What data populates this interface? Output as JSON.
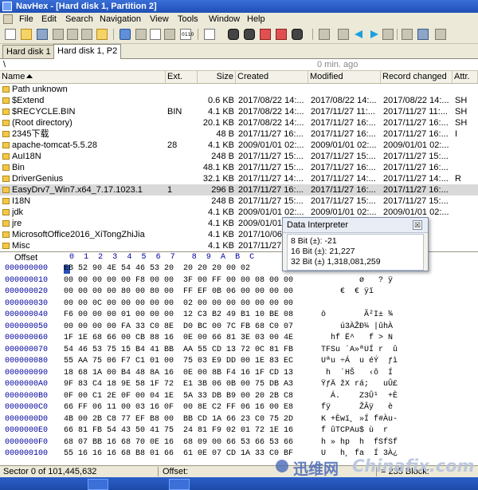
{
  "window": {
    "title": "NavHex - [Hard disk 1, Partition 2]"
  },
  "menu": [
    "File",
    "Edit",
    "Search",
    "Navigation",
    "View",
    "Tools",
    "Window",
    "Help"
  ],
  "toolbar_small_labels": {
    "hex1": "0110",
    "hex2": "HEX",
    "hex3": "HEX",
    "hex4": "HEX"
  },
  "tabs": [
    {
      "label": "Hard disk 1",
      "active": false
    },
    {
      "label": "Hard disk 1, P2",
      "active": true
    }
  ],
  "path": {
    "value": "\\",
    "ago": "0 min. ago"
  },
  "file_columns": [
    "Name",
    "Ext.",
    "Size",
    "Created",
    "Modified",
    "Record changed",
    "Attr."
  ],
  "files": [
    {
      "name": "Path unknown",
      "ext": "",
      "size": "",
      "created": "",
      "modified": "",
      "changed": "",
      "attr": ""
    },
    {
      "name": "$Extend",
      "ext": "",
      "size": "0.6 KB",
      "created": "2017/08/22  14:...",
      "modified": "2017/08/22  14:...",
      "changed": "2017/08/22  14:...",
      "attr": "SH"
    },
    {
      "name": "$RECYCLE.BIN",
      "ext": "BIN",
      "size": "4.1 KB",
      "created": "2017/08/22  14:...",
      "modified": "2017/11/27  11:...",
      "changed": "2017/11/27  11:...",
      "attr": "SH"
    },
    {
      "name": "(Root directory)",
      "ext": "",
      "size": "20.1 KB",
      "created": "2017/08/22  14:...",
      "modified": "2017/11/27  16:...",
      "changed": "2017/11/27  16:...",
      "attr": "SH"
    },
    {
      "name": "2345下载",
      "ext": "",
      "size": "48 B",
      "created": "2017/11/27  16:...",
      "modified": "2017/11/27  16:...",
      "changed": "2017/11/27  16:...",
      "attr": "I"
    },
    {
      "name": "apache-tomcat-5.5.28",
      "ext": "28",
      "size": "4.1 KB",
      "created": "2009/01/01  02:...",
      "modified": "2009/01/01  02:...",
      "changed": "2009/01/01  02:...",
      "attr": ""
    },
    {
      "name": "AuI18N",
      "ext": "",
      "size": "248 B",
      "created": "2017/11/27  15:...",
      "modified": "2017/11/27  15:...",
      "changed": "2017/11/27  15:...",
      "attr": ""
    },
    {
      "name": "Bin",
      "ext": "",
      "size": "48.1 KB",
      "created": "2017/11/27  15:...",
      "modified": "2017/11/27  16:...",
      "changed": "2017/11/27  16:...",
      "attr": ""
    },
    {
      "name": "DriverGenius",
      "ext": "",
      "size": "32.1 KB",
      "created": "2017/11/27  14:...",
      "modified": "2017/11/27  14:...",
      "changed": "2017/11/27  14:...",
      "attr": "R"
    },
    {
      "name": "EasyDrv7_Win7.x64_7.17.1023.1",
      "ext": "1",
      "size": "296 B",
      "created": "2017/11/27  16:...",
      "modified": "2017/11/27  16:...",
      "changed": "2017/11/27  16:...",
      "attr": "",
      "selected": true
    },
    {
      "name": "I18N",
      "ext": "",
      "size": "248 B",
      "created": "2017/11/27  15:...",
      "modified": "2017/11/27  15:...",
      "changed": "2017/11/27  15:...",
      "attr": ""
    },
    {
      "name": "jdk",
      "ext": "",
      "size": "4.1 KB",
      "created": "2009/01/01  02:...",
      "modified": "2009/01/01  02:...",
      "changed": "2009/01/01  02:...",
      "attr": ""
    },
    {
      "name": "jre",
      "ext": "",
      "size": "4.1 KB",
      "created": "2009/01/01  02:...",
      "modified": "2009/01/01  02:...",
      "changed": "",
      "attr": ""
    },
    {
      "name": "MicrosoftOffice2016_XiTongZhiJia",
      "ext": "",
      "size": "4.1 KB",
      "created": "2017/10/06  ...",
      "modified": "",
      "changed": "",
      "attr": ""
    },
    {
      "name": "Misc",
      "ext": "",
      "size": "4.1 KB",
      "created": "2017/11/27  ...",
      "modified": "",
      "changed": "",
      "attr": ""
    }
  ],
  "hex": {
    "offset_label": "Offset",
    "columns": [
      "0",
      "1",
      "2",
      "3",
      "4",
      "5",
      "6",
      "7",
      "8",
      "9",
      "A",
      "B",
      "C"
    ],
    "rows": [
      {
        "off": "000000000",
        "bytes": "EB 52 90 4E 54 46 53 20  20 20 20 00 02",
        "ascii": ""
      },
      {
        "off": "000000010",
        "bytes": "00 00 00 00 00 F8 00 00  3F 00 FF 00 00 08 00 00",
        "ascii": "        ø   ? ÿ"
      },
      {
        "off": "000000020",
        "bytes": "00 00 00 00 80 00 80 00  FF EF 0B 06 00 00 00 00",
        "ascii": "    €  € ÿï"
      },
      {
        "off": "000000030",
        "bytes": "00 00 0C 00 00 00 00 00  02 00 00 00 00 00 00 00",
        "ascii": ""
      },
      {
        "off": "000000040",
        "bytes": "F6 00 00 00 01 00 00 00  12 C3 B2 49 B1 10 BE 08",
        "ascii": "ö        Ã²I± ¾"
      },
      {
        "off": "000000050",
        "bytes": "00 00 00 00 FA 33 C0 8E  D0 BC 00 7C FB 68 C0 07",
        "ascii": "    ú3ÀŽÐ¼ |ûhÀ"
      },
      {
        "off": "000000060",
        "bytes": "1F 1E 68 66 00 CB 88 16  0E 00 66 81 3E 03 00 4E",
        "ascii": "  hf Ë^   f > N"
      },
      {
        "off": "000000070",
        "bytes": "54 46 53 75 15 B4 41 BB  AA 55 CD 13 72 0C 81 FB",
        "ascii": "TFSu ´A»ªUÍ r  û"
      },
      {
        "off": "000000080",
        "bytes": "55 AA 75 06 F7 C1 01 00  75 03 E9 DD 00 1E 83 EC",
        "ascii": "Uªu ÷Á  u éÝ  ƒì"
      },
      {
        "off": "000000090",
        "bytes": "18 68 1A 00 B4 48 8A 16  0E 00 8B F4 16 1F CD 13",
        "ascii": " h  ´HŠ   ‹ô  Í"
      },
      {
        "off": "0000000A0",
        "bytes": "9F 83 C4 18 9E 58 1F 72  E1 3B 06 0B 00 75 DB A3",
        "ascii": "ŸƒÄ žX rá;   uÛ£"
      },
      {
        "off": "0000000B0",
        "bytes": "0F 00 C1 2E 0F 00 04 1E  5A 33 DB B9 00 20 2B C8",
        "ascii": "  Á.    Z3Û¹  +È"
      },
      {
        "off": "0000000C0",
        "bytes": "66 FF 06 11 00 03 16 0F  00 8E C2 FF 06 16 00 E8",
        "ascii": "fÿ      ŽÂÿ   è"
      },
      {
        "off": "0000000D0",
        "bytes": "4B 00 2B C8 77 EF B8 00  BB CD 1A 66 23 C0 75 2D",
        "ascii": "K +Èwï¸ »Í f#Àu-"
      },
      {
        "off": "0000000E0",
        "bytes": "66 81 FB 54 43 50 41 75  24 81 F9 02 01 72 1E 16",
        "ascii": "f ûTCPAu$ ù  r"
      },
      {
        "off": "0000000F0",
        "bytes": "68 07 BB 16 68 70 0E 16  68 09 00 66 53 66 53 66",
        "ascii": "h » hp  h  fSfSf"
      },
      {
        "off": "000000100",
        "bytes": "55 16 16 16 68 B8 01 66  61 0E 07 CD 1A 33 C0 BF",
        "ascii": "U   h¸ fa  Í 3À¿"
      }
    ]
  },
  "status": {
    "sector": "Sector 0 of 101,445,632",
    "offset": "Offset:",
    "right": "= 235 Block:"
  },
  "data_interpreter": {
    "title": "Data Interpreter",
    "close_glyph": "☒",
    "lines": [
      "8 Bit (±): -21",
      "16 Bit (±): 21,227",
      "32 Bit (±) 1,318,081,259"
    ]
  },
  "watermark": {
    "cn": "迅维网",
    "en": "Chinafix.com"
  }
}
